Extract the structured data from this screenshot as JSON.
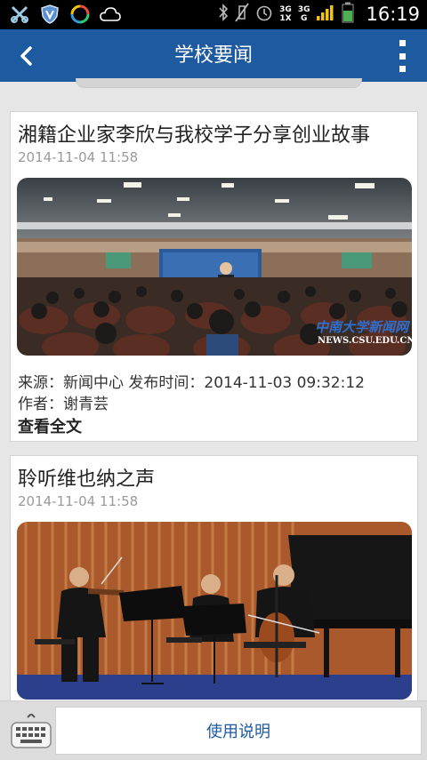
{
  "status_bar": {
    "time": "16:19",
    "network_top": "3G",
    "network_bottom": "1X",
    "network2_top": "3G",
    "network2_bottom": "G",
    "icons": [
      "usb-debug-icon",
      "shield-icon",
      "sync-icon",
      "cloud-icon",
      "bluetooth-icon",
      "mute-icon",
      "alarm-icon",
      "signal-icon",
      "battery-icon"
    ]
  },
  "header": {
    "title": "学校要闻",
    "back_icon": "chevron-left-icon",
    "menu_icon": "overflow-menu-icon",
    "color": "#1e5aa0"
  },
  "articles": [
    {
      "title": "湘籍企业家李欣与我校学子分享创业故事",
      "date": "2014-11-04 11:58",
      "photo_caption_cn": "中南大学新闻网",
      "photo_caption_en": "NEWS.CSU.EDU.CN",
      "source_line": "来源：新闻中心  发布时间：2014-11-03 09:32:12",
      "author_line": "作者：谢青芸",
      "read_more": "查看全文"
    },
    {
      "title": "聆听维也纳之声",
      "date": "2014-11-04 11:58"
    }
  ],
  "bottom_bar": {
    "keyboard_icon": "keyboard-icon",
    "help_label": "使用说明"
  }
}
